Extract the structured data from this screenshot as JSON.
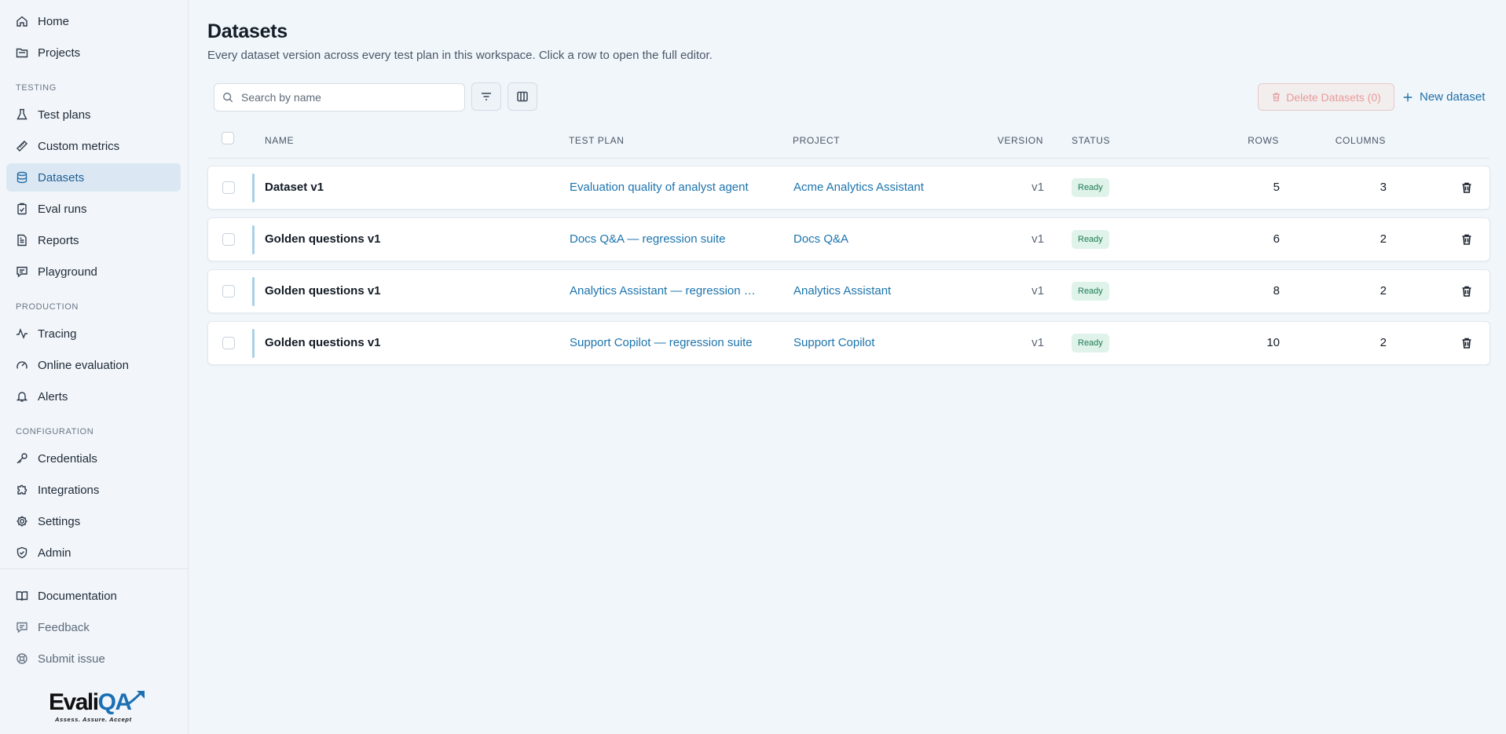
{
  "sidebar": {
    "top_items": [
      {
        "label": "Home",
        "icon": "home-icon"
      },
      {
        "label": "Projects",
        "icon": "folder-icon"
      }
    ],
    "sections": [
      {
        "label": "TESTING",
        "items": [
          {
            "label": "Test plans",
            "icon": "flask-icon"
          },
          {
            "label": "Custom metrics",
            "icon": "ruler-icon"
          },
          {
            "label": "Datasets",
            "icon": "database-icon",
            "active": true
          },
          {
            "label": "Eval runs",
            "icon": "clipboard-check-icon"
          },
          {
            "label": "Reports",
            "icon": "file-text-icon"
          },
          {
            "label": "Playground",
            "icon": "chat-icon"
          }
        ]
      },
      {
        "label": "PRODUCTION",
        "items": [
          {
            "label": "Tracing",
            "icon": "activity-icon"
          },
          {
            "label": "Online evaluation",
            "icon": "gauge-icon"
          },
          {
            "label": "Alerts",
            "icon": "bell-icon"
          }
        ]
      },
      {
        "label": "CONFIGURATION",
        "items": [
          {
            "label": "Credentials",
            "icon": "key-icon"
          },
          {
            "label": "Integrations",
            "icon": "puzzle-icon"
          },
          {
            "label": "Settings",
            "icon": "gear-icon"
          },
          {
            "label": "Admin",
            "icon": "shield-check-icon"
          }
        ]
      }
    ],
    "bottom_items": [
      {
        "label": "Documentation",
        "icon": "book-icon"
      },
      {
        "label": "Feedback",
        "icon": "message-icon"
      },
      {
        "label": "Submit issue",
        "icon": "lifebuoy-icon"
      }
    ],
    "logo": {
      "word_a": "Evali",
      "word_b": "QA",
      "tagline": "Assess. Assure. Accept"
    }
  },
  "page": {
    "title": "Datasets",
    "subtitle": "Every dataset version across every test plan in this workspace. Click a row to open the full editor."
  },
  "toolbar": {
    "search_placeholder": "Search by name",
    "filter_icon": "filter-icon",
    "columns_icon": "columns-icon",
    "delete_label": "Delete Datasets (0)",
    "new_label": "New dataset"
  },
  "table": {
    "headers": {
      "name": "NAME",
      "test_plan": "TEST PLAN",
      "project": "PROJECT",
      "version": "VERSION",
      "status": "STATUS",
      "rows": "ROWS",
      "columns": "COLUMNS"
    },
    "rows": [
      {
        "name": "Dataset v1",
        "test_plan": "Evaluation quality of analyst agent",
        "project": "Acme Analytics Assistant",
        "version": "v1",
        "status": "Ready",
        "rows": "5",
        "columns": "3"
      },
      {
        "name": "Golden questions v1",
        "test_plan": "Docs Q&A — regression suite",
        "project": "Docs Q&A",
        "version": "v1",
        "status": "Ready",
        "rows": "6",
        "columns": "2"
      },
      {
        "name": "Golden questions v1",
        "test_plan": "Analytics Assistant — regression s...",
        "project": "Analytics Assistant",
        "version": "v1",
        "status": "Ready",
        "rows": "8",
        "columns": "2"
      },
      {
        "name": "Golden questions v1",
        "test_plan": "Support Copilot — regression suite",
        "project": "Support Copilot",
        "version": "v1",
        "status": "Ready",
        "rows": "10",
        "columns": "2"
      }
    ]
  },
  "colors": {
    "accent": "#1c74ad",
    "active_nav_bg": "#dbe8f3",
    "status_bg": "#dff3ea",
    "status_text": "#1d7b52",
    "danger_text": "#e79a9a"
  }
}
